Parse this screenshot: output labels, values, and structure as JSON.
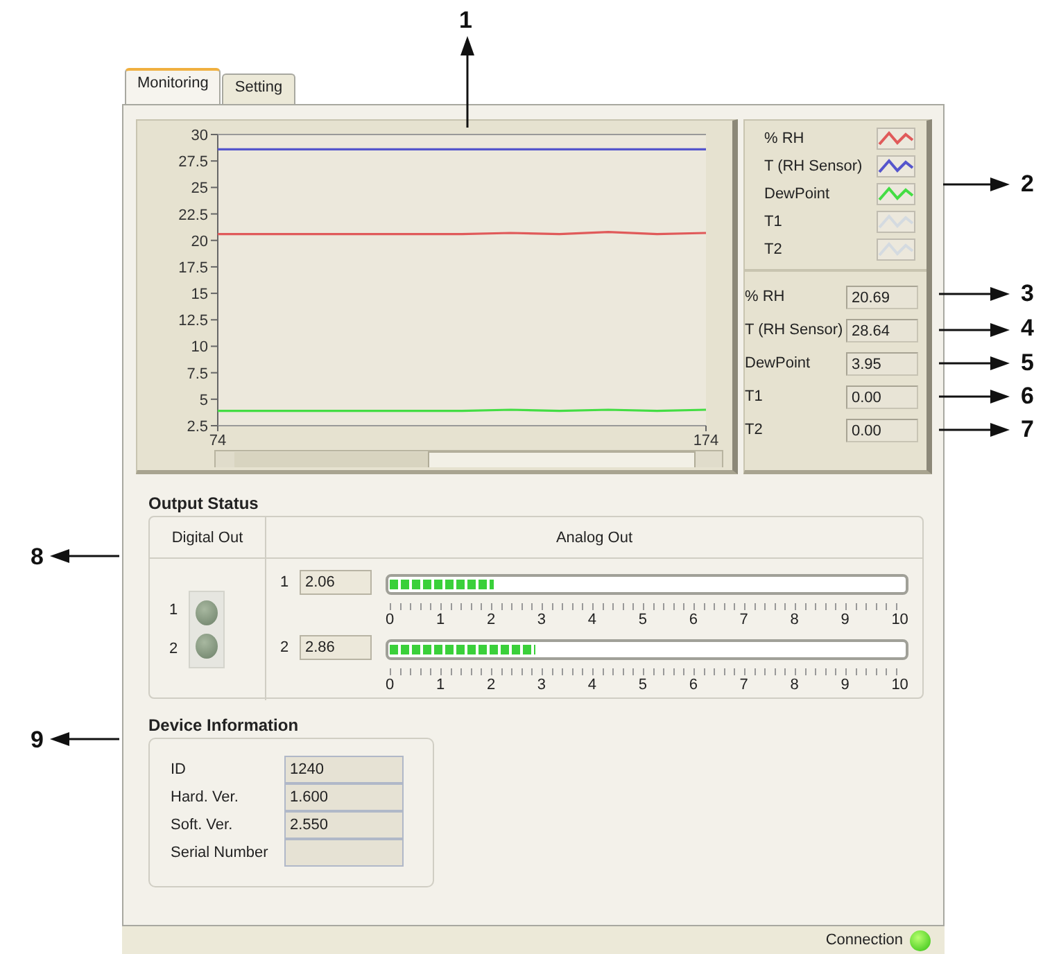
{
  "tabs": [
    {
      "label": "Monitoring",
      "selected": true
    },
    {
      "label": "Setting",
      "selected": false
    }
  ],
  "chart": {
    "chart_data": {
      "type": "line",
      "x": [
        74,
        84,
        94,
        104,
        114,
        124,
        134,
        144,
        154,
        164,
        174
      ],
      "xlim": [
        74,
        174
      ],
      "ylim": [
        2.5,
        30
      ],
      "xticks": [
        74,
        174
      ],
      "yticks": [
        {
          "value": 2.5,
          "label": "2.5"
        },
        {
          "value": 5,
          "label": "5"
        },
        {
          "value": 7.5,
          "label": "7.5"
        },
        {
          "value": 10,
          "label": "10"
        },
        {
          "value": 12.5,
          "label": "12.5"
        },
        {
          "value": 15,
          "label": "15"
        },
        {
          "value": 17.5,
          "label": "17.5"
        },
        {
          "value": 20,
          "label": "20"
        },
        {
          "value": 22.5,
          "label": "22.5"
        },
        {
          "value": 25,
          "label": "25"
        },
        {
          "value": 27.5,
          "label": "27.5"
        },
        {
          "value": 30,
          "label": "30"
        }
      ],
      "series": [
        {
          "name": "% RH",
          "color": "#e05a5a",
          "values": [
            20.6,
            20.6,
            20.6,
            20.6,
            20.6,
            20.6,
            20.7,
            20.6,
            20.8,
            20.6,
            20.7
          ]
        },
        {
          "name": "T (RH Sensor)",
          "color": "#5555cc",
          "values": [
            28.6,
            28.6,
            28.6,
            28.6,
            28.6,
            28.6,
            28.6,
            28.6,
            28.6,
            28.6,
            28.6
          ]
        },
        {
          "name": "DewPoint",
          "color": "#44dd44",
          "values": [
            3.9,
            3.9,
            3.9,
            3.9,
            3.9,
            3.9,
            4.0,
            3.9,
            4.0,
            3.9,
            4.0
          ]
        },
        {
          "name": "T1",
          "color": "#d4dae0",
          "values": [
            null,
            null,
            null,
            null,
            null,
            null,
            null,
            null,
            null,
            null,
            null
          ]
        },
        {
          "name": "T2",
          "color": "#d4dae0",
          "values": [
            null,
            null,
            null,
            null,
            null,
            null,
            null,
            null,
            null,
            null,
            null
          ]
        }
      ]
    }
  },
  "readings": [
    {
      "label": "% RH",
      "value": "20.69"
    },
    {
      "label": "T (RH Sensor)",
      "value": "28.64"
    },
    {
      "label": "DewPoint",
      "value": "3.95"
    },
    {
      "label": "T1",
      "value": "0.00"
    },
    {
      "label": "T2",
      "value": "0.00"
    }
  ],
  "output_status": {
    "title": "Output Status",
    "digital_header": "Digital Out",
    "analog_header": "Analog Out",
    "digital_out": [
      {
        "label": "1",
        "on": false
      },
      {
        "label": "2",
        "on": false
      }
    ],
    "analog_out": [
      {
        "label": "1",
        "value": "2.06",
        "level": 0.206,
        "scale": [
          "0",
          "1",
          "2",
          "3",
          "4",
          "5",
          "6",
          "7",
          "8",
          "9",
          "10"
        ]
      },
      {
        "label": "2",
        "value": "2.86",
        "level": 0.286,
        "scale": [
          "0",
          "1",
          "2",
          "3",
          "4",
          "5",
          "6",
          "7",
          "8",
          "9",
          "10"
        ]
      }
    ]
  },
  "device_info": {
    "title": "Device Information",
    "fields": [
      {
        "label": "ID",
        "value": "1240"
      },
      {
        "label": "Hard. Ver.",
        "value": "1.600"
      },
      {
        "label": "Soft. Ver.",
        "value": "2.550"
      },
      {
        "label": "Serial Number"
      }
    ]
  },
  "status_bar": {
    "label": "Connection",
    "connected": true
  },
  "callouts": [
    "1",
    "2",
    "3",
    "4",
    "5",
    "6",
    "7",
    "8",
    "9"
  ]
}
